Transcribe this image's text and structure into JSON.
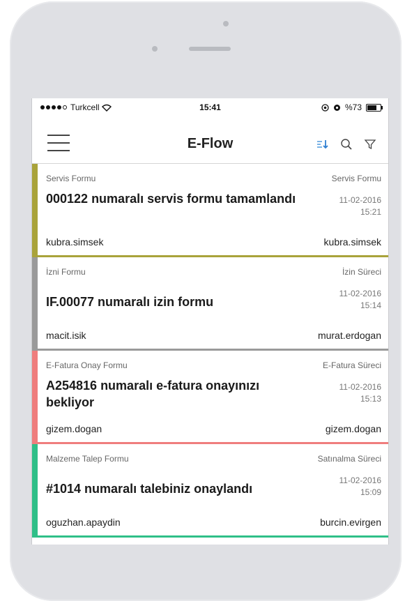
{
  "status_bar": {
    "carrier": "Turkcell",
    "time": "15:41",
    "battery": "%73"
  },
  "nav": {
    "title": "E-Flow"
  },
  "items": [
    {
      "form": "Servis Formu",
      "process": "Servis Formu",
      "title": "000122 numaralı servis formu tamamlandı",
      "date": "11-02-2016",
      "time": "15:21",
      "from": "kubra.simsek",
      "to": "kubra.simsek",
      "color": "#a9a33a"
    },
    {
      "form": "İzni Formu",
      "process": "İzin Süreci",
      "title": "IF.00077 numaralı izin formu",
      "date": "11-02-2016",
      "time": "15:14",
      "from": "macit.isik",
      "to": "murat.erdogan",
      "color": "#9a9a9a"
    },
    {
      "form": "E-Fatura Onay Formu",
      "process": "E-Fatura Süreci",
      "title": "A254816 numaralı e-fatura onayınızı bekliyor",
      "date": "11-02-2016",
      "time": "15:13",
      "from": "gizem.dogan",
      "to": "gizem.dogan",
      "color": "#ef7d7d"
    },
    {
      "form": "Malzeme Talep Formu",
      "process": "Satınalma Süreci",
      "title": "#1014 numaralı talebiniz onaylandı",
      "date": "11-02-2016",
      "time": "15:09",
      "from": "oguzhan.apaydin",
      "to": "burcin.evirgen",
      "color": "#2fbf88"
    }
  ]
}
